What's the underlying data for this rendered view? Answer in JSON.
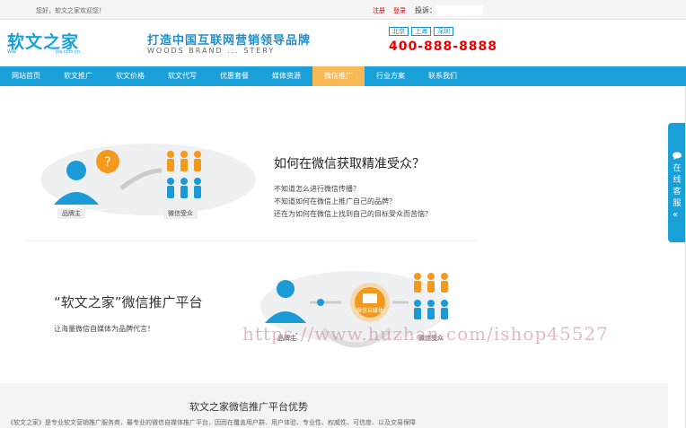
{
  "topbar": {
    "welcome": "您好，软文之家欢迎您！",
    "register": "注册",
    "login": "登录",
    "contact_label": "投诉："
  },
  "header": {
    "logo": "软文之家",
    "logo_url": "WW",
    "logo_url2": "ijia.com.cn",
    "slogan": "打造中国互联网营销领导品牌",
    "slogan_en": "WOODS BRAND ... STERY",
    "cities": [
      "北京",
      "上海",
      "深圳"
    ],
    "phone": "400-888-8888"
  },
  "nav": {
    "items": [
      "网站首页",
      "软文推广",
      "软文价格",
      "软文代写",
      "优惠套餐",
      "媒体资源",
      "微信推广",
      "行业方案",
      "联系我们"
    ],
    "active_index": 6
  },
  "section1": {
    "title": "如何在微信获取精准受众？",
    "questions": [
      "不知道怎么进行微信传播？",
      "不知道如何在微信上推广自己的品牌？",
      "还在为如何在微信上找到自己的目标受众而苦恼？"
    ],
    "brand_label": "品牌主",
    "audience_label": "微信受众"
  },
  "section2": {
    "title": "“软文之家”微信推广平台",
    "subtitle": "让海量微信自媒体为品牌代言！",
    "center_label": "微信自媒体",
    "left_label": "品牌主",
    "right_label": "微信受众"
  },
  "watermark": "https://www.huzhan.com/ishop45527",
  "advantages": {
    "title": "软文之家微信推广平台优势",
    "text": "《软文之家》是专业软文营销推广服务商，最专业的微信自媒体推广平台，因而在覆盖用户群、用户体验、专业性、权威性、可信度、以及交易保障"
  },
  "side_tab": {
    "text": "在线客服",
    "chevron": "«"
  },
  "colors": {
    "brand_blue": "#1aa0d8",
    "nav_active": "#f7b955",
    "phone_red": "#ee0000",
    "person_blue": "#1a9ad6",
    "person_orange": "#f39a1e"
  }
}
